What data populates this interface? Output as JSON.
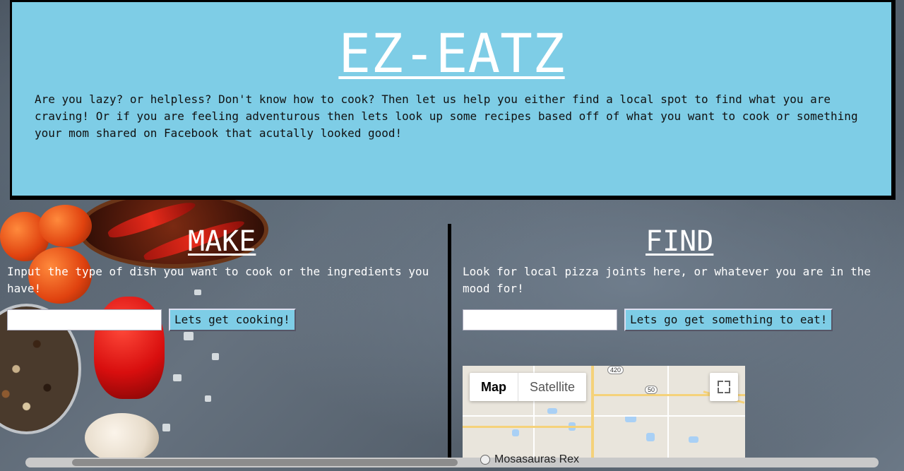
{
  "header": {
    "title": "EZ-EATZ",
    "intro": "Are you lazy? or helpless? Don't know how to cook? Then let us help you either find a local spot to find what you are craving! Or if you are feeling adventurous then lets look up some recipes based off of what you want to cook or something your mom shared on Facebook that acutally looked good!"
  },
  "make": {
    "heading": "MAKE",
    "text": "Input the type of dish you want to cook or the ingredients you have!",
    "input_value": "",
    "button_label": "Lets get cooking!"
  },
  "find": {
    "heading": "FIND",
    "text": "Look for local pizza joints here, or whatever you are in the mood for!",
    "input_value": "",
    "button_label": "Lets go get something to eat!"
  },
  "map": {
    "type_options": [
      "Map",
      "Satellite"
    ],
    "selected_type": "Map",
    "route_shields": [
      "420",
      "50"
    ]
  },
  "bottom": {
    "radio_label": "Mosasauras Rex"
  },
  "colors": {
    "accent": "#7ecde6",
    "border": "#000000",
    "text_light": "#ffffff"
  }
}
